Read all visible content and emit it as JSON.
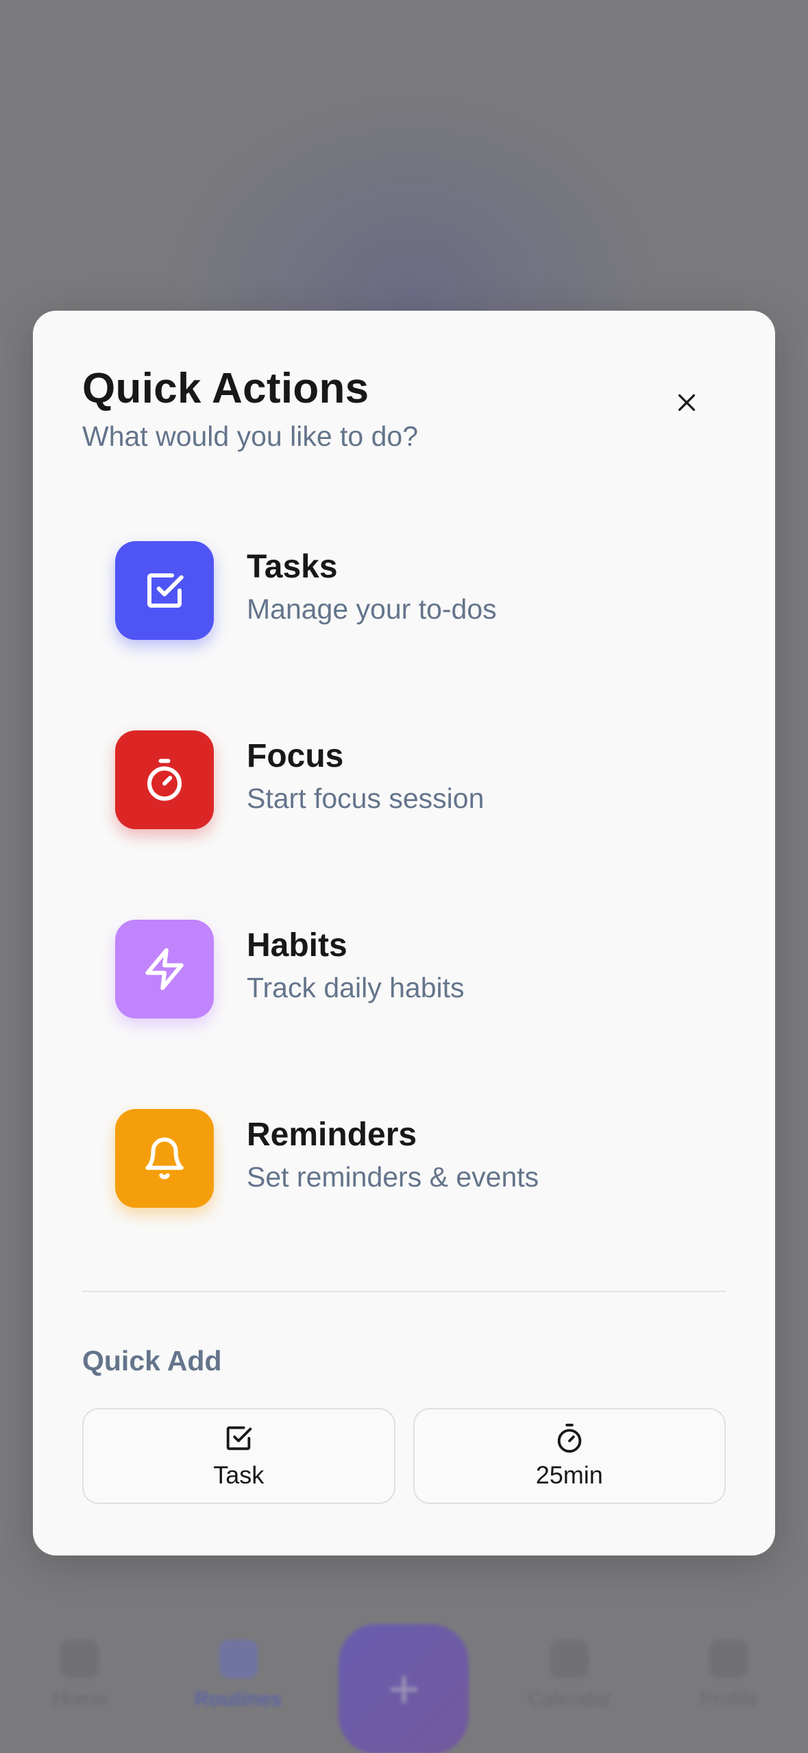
{
  "modal": {
    "title": "Quick Actions",
    "subtitle": "What would you like to do?"
  },
  "actions": [
    {
      "label": "Tasks",
      "description": "Manage your to-dos",
      "icon": "checkbox-icon",
      "color": "#4f55f5"
    },
    {
      "label": "Focus",
      "description": "Start focus session",
      "icon": "timer-icon",
      "color": "#dc2626"
    },
    {
      "label": "Habits",
      "description": "Track daily habits",
      "icon": "lightning-icon",
      "color": "#c084fc"
    },
    {
      "label": "Reminders",
      "description": "Set reminders & events",
      "icon": "bell-icon",
      "color": "#f59e0b"
    }
  ],
  "quick_add": {
    "label": "Quick Add",
    "buttons": [
      {
        "label": "Task",
        "icon": "checkbox-icon"
      },
      {
        "label": "25min",
        "icon": "timer-icon"
      }
    ]
  },
  "background_nav": {
    "items": [
      "Home",
      "Routines",
      "Calendar",
      "Profile"
    ]
  }
}
